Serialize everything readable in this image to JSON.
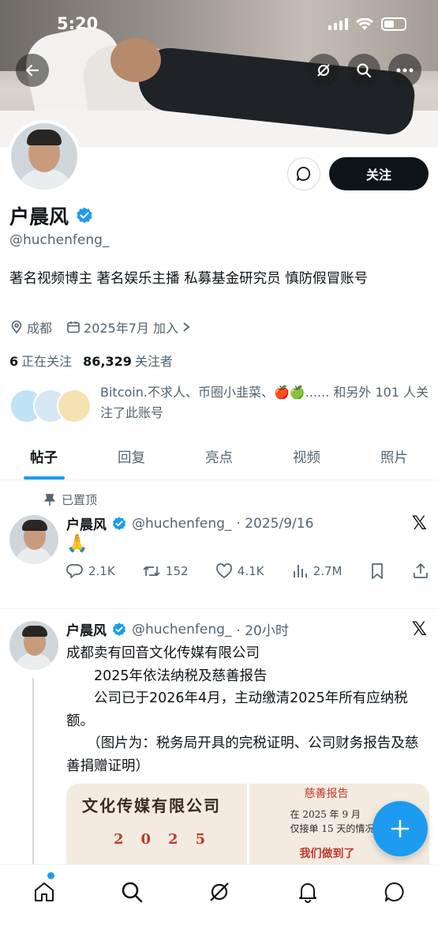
{
  "status_bar": {
    "time": "5:20"
  },
  "profile": {
    "name": "户晨风",
    "handle": "@huchenfeng_",
    "bio": "著名视频博主 著名娱乐主播 私募基金研究员 慎防假冒账号",
    "location": "成都",
    "joined": "2025年7月 加入",
    "following_count": "6",
    "following_label": "正在关注",
    "followers_count": "86,329",
    "followers_label": "关注者",
    "followed_by_text": "Bitcoin.不求人、币圈小韭菜、🍎🍏...... 和另外 101 人关注了此账号",
    "follow_button": "关注"
  },
  "tabs": [
    {
      "label": "帖子"
    },
    {
      "label": "回复"
    },
    {
      "label": "亮点"
    },
    {
      "label": "视频"
    },
    {
      "label": "照片"
    }
  ],
  "posts": [
    {
      "pinned_label": "已置顶",
      "name": "户晨风",
      "handle": "@huchenfeng_",
      "date": "· 2025/9/16",
      "content": "🙏",
      "replies": "2.1K",
      "reposts": "152",
      "likes": "4.1K",
      "views": "2.7M"
    },
    {
      "name": "户晨风",
      "handle": "@huchenfeng_",
      "date": "· 20小时",
      "content_lines": [
        "成都卖有回音文化传媒有限公司",
        "　　2025年依法纳税及慈善报告",
        "　　公司已于2026年4月，主动缴清2025年所有应纳税额。",
        "　　（图片为：税务局开具的完税证明、公司财务报告及慈善捐赠证明）"
      ],
      "media_left_line1": "文化传媒有限公司",
      "media_left_line2": "2025",
      "media_right_line0": "慈善报告",
      "media_right_line1": "在 2025 年 9 月",
      "media_right_line2": "仅接单 15 天的情况",
      "media_right_line3": "我们做到了"
    }
  ],
  "colors": {
    "accent": "#1d9bf0",
    "text": "#0f1419",
    "secondary": "#536471"
  }
}
